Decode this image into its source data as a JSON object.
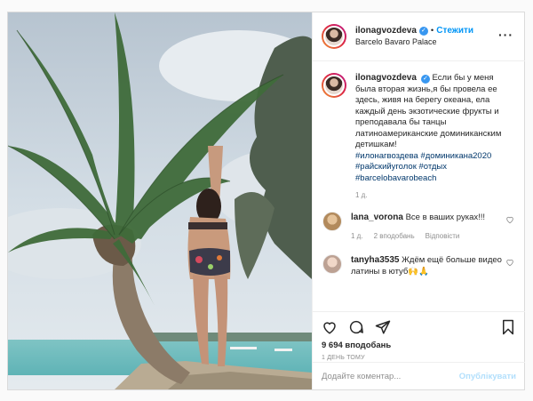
{
  "post": {
    "username": "ilonagvozdeva",
    "follow_label": "Стежити",
    "location": "Barcelo Bavaro Palace",
    "caption": {
      "username": "ilonagvozdeva",
      "text": "Если бы у меня была вторая жизнь,я бы провела ее здесь, живя на берегу океана, ела каждый день экзотические фрукты и преподавала бы танцы латиноамериканские доминиканским детишкам!",
      "hashtags_line1": "#илонагвоздева #доминикана2020",
      "hashtags_line2": "#райскийуголок #отдых",
      "hashtags_line3": "#barcelobavarobeach",
      "age": "1 д."
    },
    "comments": [
      {
        "username": "lana_vorona",
        "text": "Все в ваших руках!!!",
        "age": "1 д.",
        "likes": "2 вподобань",
        "reply": "Відповісти"
      },
      {
        "username": "tanyha3535",
        "text": "Ждём ещё больше видео латины в ютуб🙌🙏"
      }
    ],
    "likes": "9 694 вподобань",
    "date": "1 день тому",
    "add_comment_placeholder": "Додайте коментар...",
    "publish_label": "Опублікувати"
  },
  "icons": {
    "more": "more-options-icon",
    "like": "heart-icon",
    "comment": "comment-icon",
    "share": "share-icon",
    "save": "bookmark-icon"
  },
  "colors": {
    "link_blue": "#0095f6",
    "hashtag": "#00376b",
    "verified": "#3897f0",
    "muted": "#8e8e8e",
    "publish_disabled": "#b2dffc"
  }
}
